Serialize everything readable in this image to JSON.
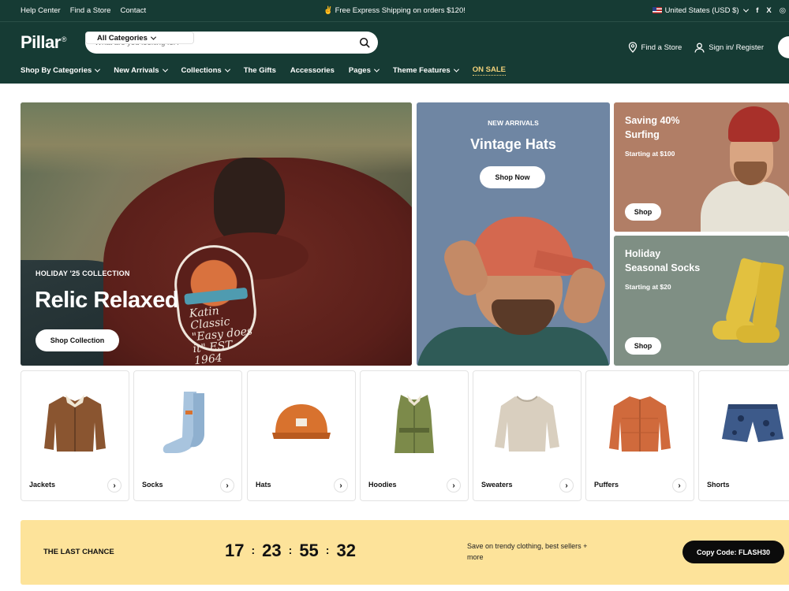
{
  "topbar": {
    "links": [
      "Help Center",
      "Find a Store",
      "Contact"
    ],
    "promo": "Free Express Shipping on orders $120!",
    "promo_icon": "hand-wave-icon",
    "currency": "United States (USD $)",
    "social": [
      "f",
      "X",
      "◎"
    ]
  },
  "header": {
    "logo": "Pillar",
    "logo_mark": "®",
    "search": {
      "category": "All Categories",
      "placeholder": "What are you looking for?"
    },
    "find_store": "Find a Store",
    "sign_in": "Sign in/ Register"
  },
  "nav": {
    "items": [
      {
        "label": "Shop By Categories",
        "has_dropdown": true
      },
      {
        "label": "New Arrivals",
        "has_dropdown": true
      },
      {
        "label": "Collections",
        "has_dropdown": true
      },
      {
        "label": "The Gifts",
        "has_dropdown": false
      },
      {
        "label": "Accessories",
        "has_dropdown": false
      },
      {
        "label": "Pages",
        "has_dropdown": true
      },
      {
        "label": "Theme Features",
        "has_dropdown": true
      }
    ],
    "sale": "ON SALE",
    "sale_color": "#f2d27a"
  },
  "hero": {
    "eyebrow": "HOLIDAY '25 COLLECTION",
    "title": "Relic Relaxed",
    "button": "Shop Collection",
    "print_text": "Katin Classic \"Easy does it\" EST 1964"
  },
  "promo_hats": {
    "eyebrow": "NEW ARRIVALS",
    "title": "Vintage Hats",
    "button": "Shop Now"
  },
  "promo_surfing": {
    "title_line1": "Saving 40%",
    "title_line2": "Surfing",
    "subtitle": "Starting at $100",
    "button": "Shop"
  },
  "promo_socks": {
    "title_line1": "Holiday",
    "title_line2": "Seasonal Socks",
    "subtitle": "Starting at $20",
    "button": "Shop"
  },
  "categories": [
    {
      "label": "Jackets",
      "color": "#8a5530"
    },
    {
      "label": "Socks",
      "color": "#a8c4de"
    },
    {
      "label": "Hats",
      "color": "#d8722e"
    },
    {
      "label": "Hoodies",
      "color": "#7c8a4a"
    },
    {
      "label": "Sweaters",
      "color": "#d9cfbf"
    },
    {
      "label": "Puffers",
      "color": "#d06a3c"
    },
    {
      "label": "Shorts",
      "color": "#3d5a8a"
    }
  ],
  "deal": {
    "title": "THE LAST CHANCE",
    "timer": {
      "days": "17",
      "hours": "23",
      "minutes": "55",
      "seconds": "32"
    },
    "description": "Save on trendy clothing, best sellers + more",
    "button": "Copy Code: FLASH30",
    "background": "#fde39a"
  },
  "colors": {
    "header_bg": "#163b34",
    "accent": "#f2d27a"
  }
}
